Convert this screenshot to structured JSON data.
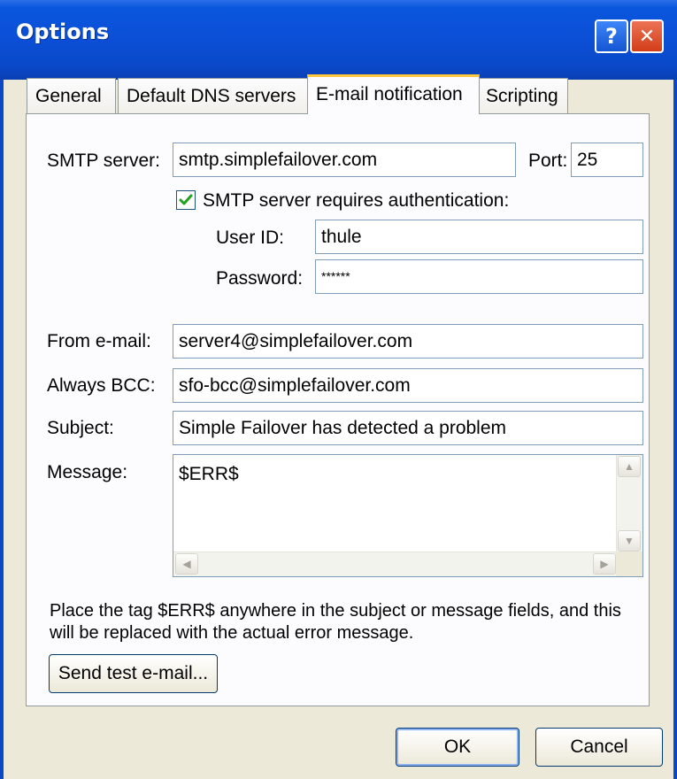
{
  "window": {
    "title": "Options"
  },
  "title_buttons": {
    "help": "?",
    "close": "✕"
  },
  "tabs": [
    {
      "label": "General"
    },
    {
      "label": "Default DNS servers"
    },
    {
      "label": "E-mail notification"
    },
    {
      "label": "Scripting"
    }
  ],
  "smtp": {
    "server_label": "SMTP server:",
    "server_value": "smtp.simplefailover.com",
    "port_label": "Port:",
    "port_value": "25",
    "auth_checked": true,
    "auth_label": "SMTP server requires authentication:",
    "userid_label": "User ID:",
    "userid_value": "thule",
    "password_label": "Password:",
    "password_value": "******"
  },
  "email": {
    "from_label": "From e-mail:",
    "from_value": "server4@simplefailover.com",
    "bcc_label": "Always BCC:",
    "bcc_value": "sfo-bcc@simplefailover.com",
    "subject_label": "Subject:",
    "subject_value": "Simple Failover has detected a problem",
    "message_label": "Message:",
    "message_value": "$ERR$"
  },
  "hint": "Place the tag $ERR$ anywhere in the subject or message fields, and this will be replaced with the actual error message.",
  "buttons": {
    "send_test": "Send test e-mail...",
    "ok": "OK",
    "cancel": "Cancel"
  },
  "colors": {
    "titlebar": "#0a48c7",
    "accent_tab": "#ffc83c",
    "close_button": "#d23d18"
  }
}
